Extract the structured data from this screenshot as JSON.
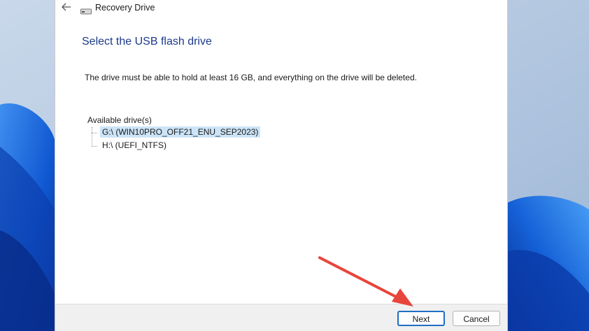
{
  "window": {
    "title": "Recovery Drive",
    "icon": "drive-icon",
    "back_icon": "back-arrow-icon"
  },
  "page": {
    "title": "Select the USB flash drive",
    "instruction": "The drive must be able to hold at least 16 GB, and everything on the drive will be deleted.",
    "drives_label": "Available drive(s)",
    "drives": [
      {
        "label": "G:\\ (WIN10PRO_OFF21_ENU_SEP2023)",
        "selected": true
      },
      {
        "label": "H:\\ (UEFI_NTFS)",
        "selected": false
      }
    ]
  },
  "footer": {
    "next_label": "Next",
    "cancel_label": "Cancel"
  },
  "colors": {
    "title_blue": "#1c3a8a",
    "selection": "#cce4f7",
    "annotation_arrow": "#e8453c"
  }
}
